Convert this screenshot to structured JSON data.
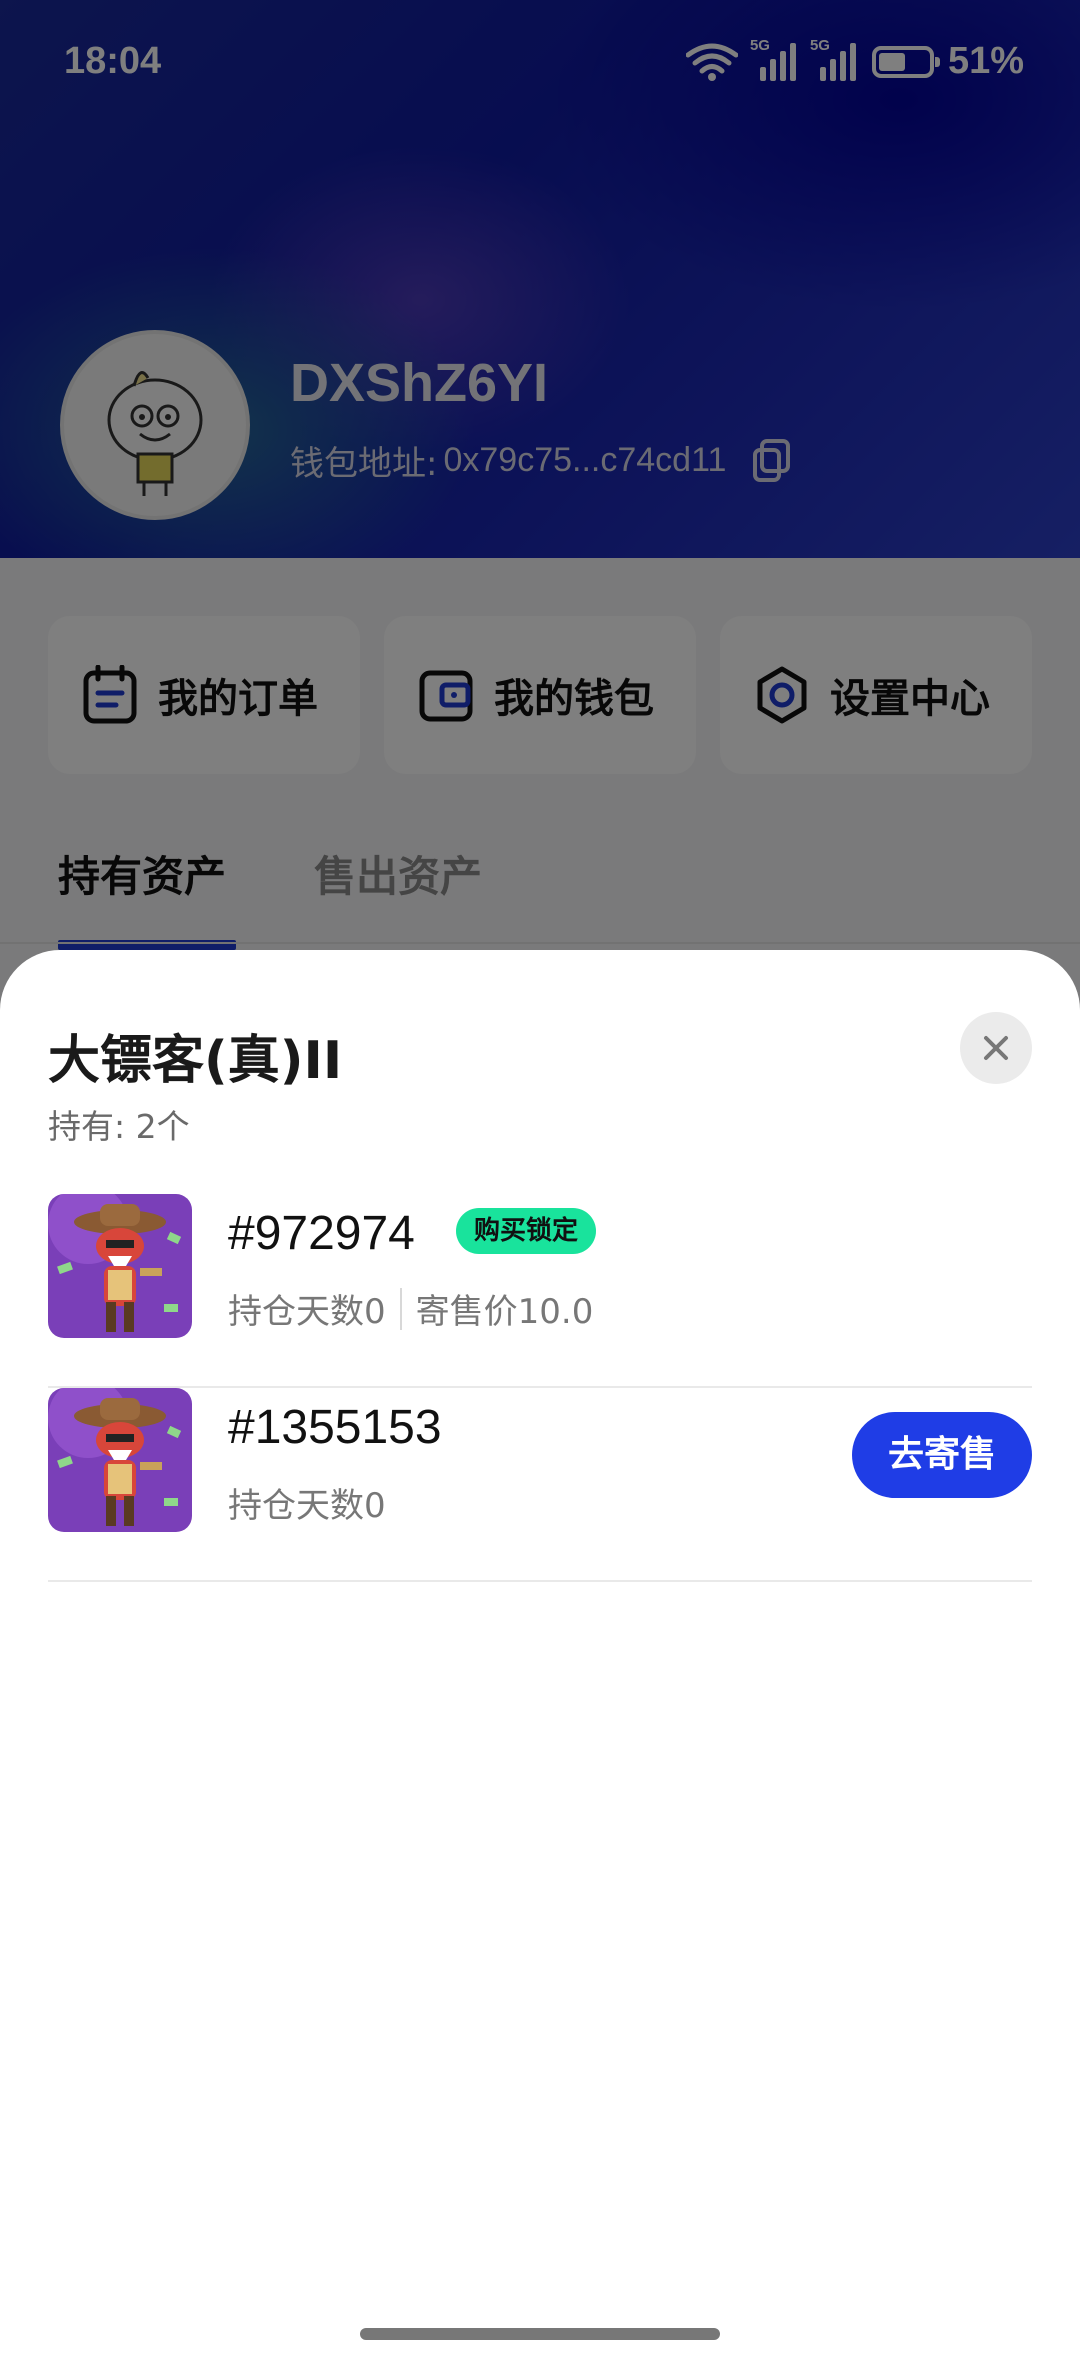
{
  "status_bar": {
    "time": "18:04",
    "battery": "51%",
    "network_tag_1": "5G",
    "network_tag_2": "5G"
  },
  "profile": {
    "username": "DXShZ6YI",
    "wallet_label": "钱包地址:",
    "wallet_address": "0x79c75...c74cd11"
  },
  "quick_actions": [
    {
      "label": "我的订单",
      "icon": "orders-icon"
    },
    {
      "label": "我的钱包",
      "icon": "wallet-icon"
    },
    {
      "label": "设置中心",
      "icon": "settings-icon"
    }
  ],
  "tabs": [
    {
      "label": "持有资产",
      "active": true
    },
    {
      "label": "售出资产",
      "active": false
    }
  ],
  "sheet": {
    "title": "大镖客(真)II",
    "holding": "持有: 2个",
    "items": [
      {
        "number": "#972974",
        "badge": "购买锁定",
        "days": "持仓天数0",
        "price": "寄售价10.0"
      },
      {
        "number": "#1355153",
        "days": "持仓天数0",
        "action": "去寄售"
      }
    ]
  },
  "colors": {
    "accent": "#1f3de6",
    "badge": "#19e39c",
    "tab_indicator": "#1f3bd1"
  }
}
